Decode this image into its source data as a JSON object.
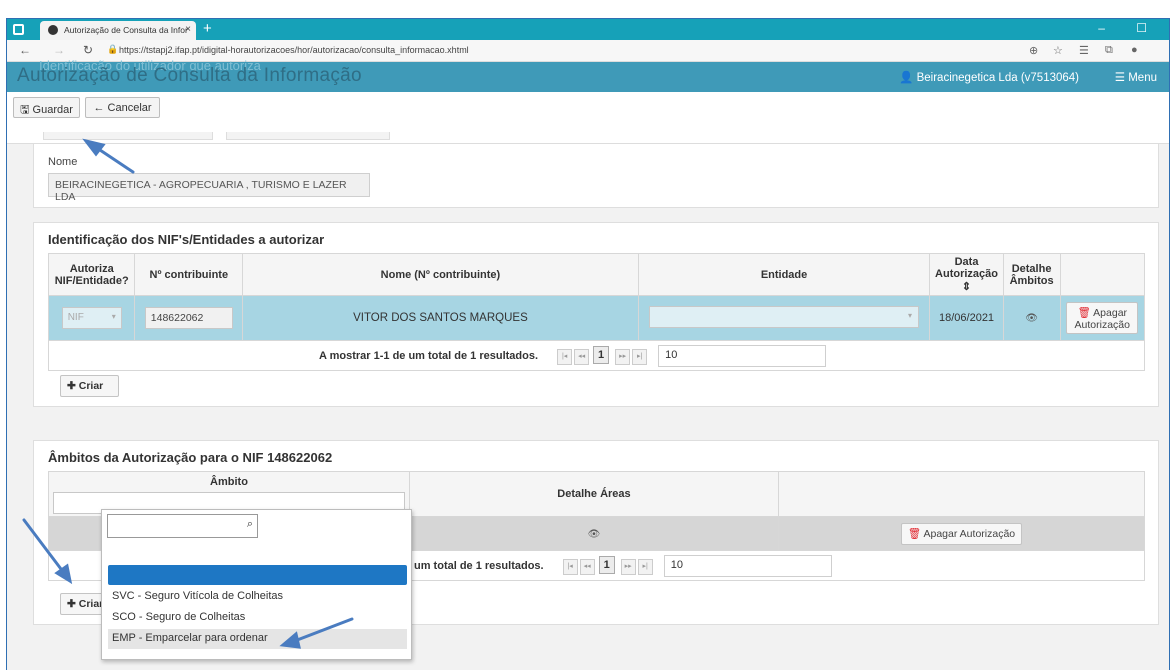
{
  "browser": {
    "tab_title": "Autorização de Consulta da Infor",
    "tab_close": "×",
    "new_tab": "+",
    "url": "https://tstapj2.ifap.pt/idigital-horautorizacoes/hor/autorizacao/consulta_informacao.xhtml",
    "window_controls": "– ☐"
  },
  "header": {
    "title": "Autorização de Consulta da Informação",
    "ghost_title": "Identificação do utilizador que autoriza",
    "user": "Beiracinegetica Lda (v7513064)",
    "menu_label": "Menu"
  },
  "toolbar": {
    "save_label": "Guardar",
    "cancel_label": "Cancelar"
  },
  "identification": {
    "name_label": "Nome",
    "name_value": "BEIRACINEGETICA - AGROPECUARIA , TURISMO E LAZER LDA"
  },
  "nif_section": {
    "title": "Identificação dos NIF's/Entidades a autorizar",
    "columns": [
      "Autoriza NIF/Entidade?",
      "Nº contribuinte",
      "Nome (Nº contribuinte)",
      "Entidade",
      "Data Autorização",
      "Detalhe Âmbitos"
    ],
    "sort_icon": "⇕",
    "row": {
      "authorize": "NIF",
      "nif": "148622062",
      "name": "VITOR DOS SANTOS MARQUES",
      "entity": "",
      "date": "18/06/2021",
      "delete_label": "Apagar Autorização"
    },
    "pagination_text": "A mostrar 1-1 de um total de 1 resultados.",
    "current_page": "1",
    "rows_per_page": "10",
    "create_label": "Criar"
  },
  "ambitos_section": {
    "title": "Âmbitos da Autorização para o NIF 148622062",
    "col_ambito": "Âmbito",
    "col_detalhe": "Detalhe Áreas",
    "delete_label": "Apagar Autorização",
    "pagination_text": "um total de 1 resultados.",
    "current_page": "1",
    "rows_per_page": "10",
    "create_label": "Criar"
  },
  "dropdown": {
    "search_value": "",
    "options": [
      "",
      "SVC - Seguro Vitícola de Colheitas",
      "SCO - Seguro de Colheitas",
      "EMP - Emparcelar para ordenar"
    ]
  },
  "colors": {
    "tabbar": "#16a1b8",
    "appbar": "#3f9ab8",
    "selected_row": "#a7d5e3",
    "highlight": "#1e77c4",
    "trash": "#e0232b",
    "annotation_arrow": "#4a7cc0"
  }
}
